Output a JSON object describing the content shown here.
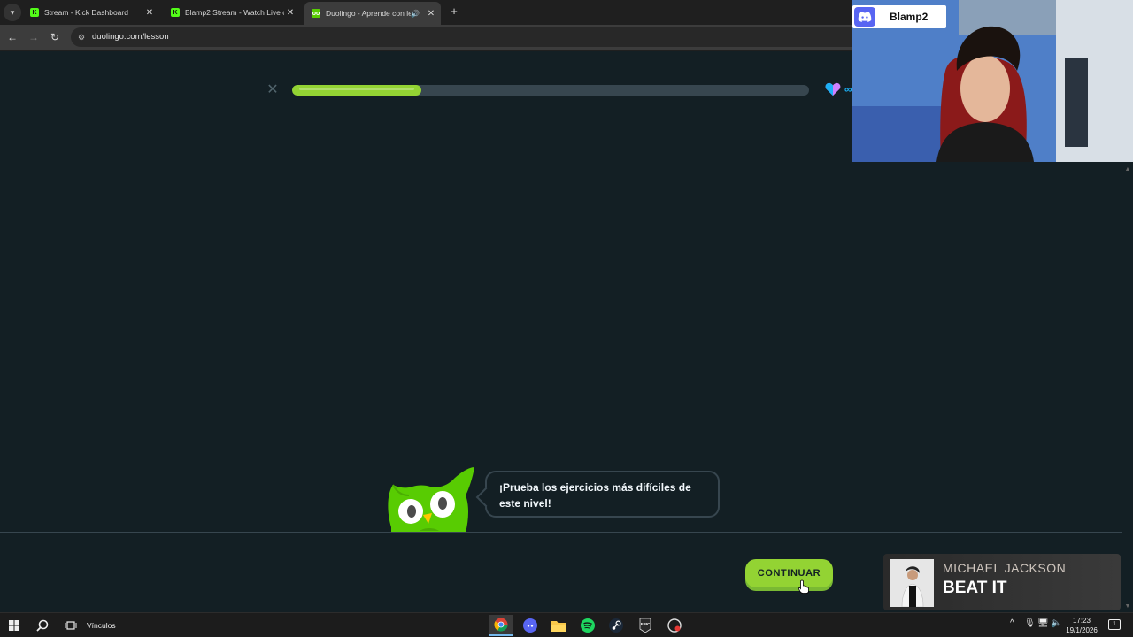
{
  "browser": {
    "tabs": [
      {
        "title": "Stream - Kick Dashboard",
        "favicon": "kick-icon",
        "active": false
      },
      {
        "title": "Blamp2 Stream - Watch Live on",
        "favicon": "kick-icon",
        "active": false
      },
      {
        "title": "Duolingo - Aprende con lecciones",
        "favicon": "duolingo-icon",
        "active": true,
        "audio": true
      }
    ],
    "new_tab_label": "+",
    "url": "duolingo.com/lesson"
  },
  "lesson": {
    "progress_fraction": 0.25,
    "hearts": "∞",
    "owl_message": "¡Prueba los ejercicios más difíciles de este nivel!",
    "continue_label": "CONTINUAR",
    "accent_color": "#93d333",
    "border_color": "#37464f",
    "background_color": "#131f24"
  },
  "overlay": {
    "discord_name": "Blamp2",
    "now_playing": {
      "artist": "MICHAEL JACKSON",
      "song": "BEAT IT"
    }
  },
  "taskbar": {
    "links_label": "Vínculos",
    "time": "17:23",
    "date": "19/1/2026",
    "pinned_apps": [
      "chrome-icon",
      "discord-icon",
      "file-explorer-icon",
      "spotify-icon",
      "steam-icon",
      "epic-games-icon",
      "app-icon"
    ]
  }
}
